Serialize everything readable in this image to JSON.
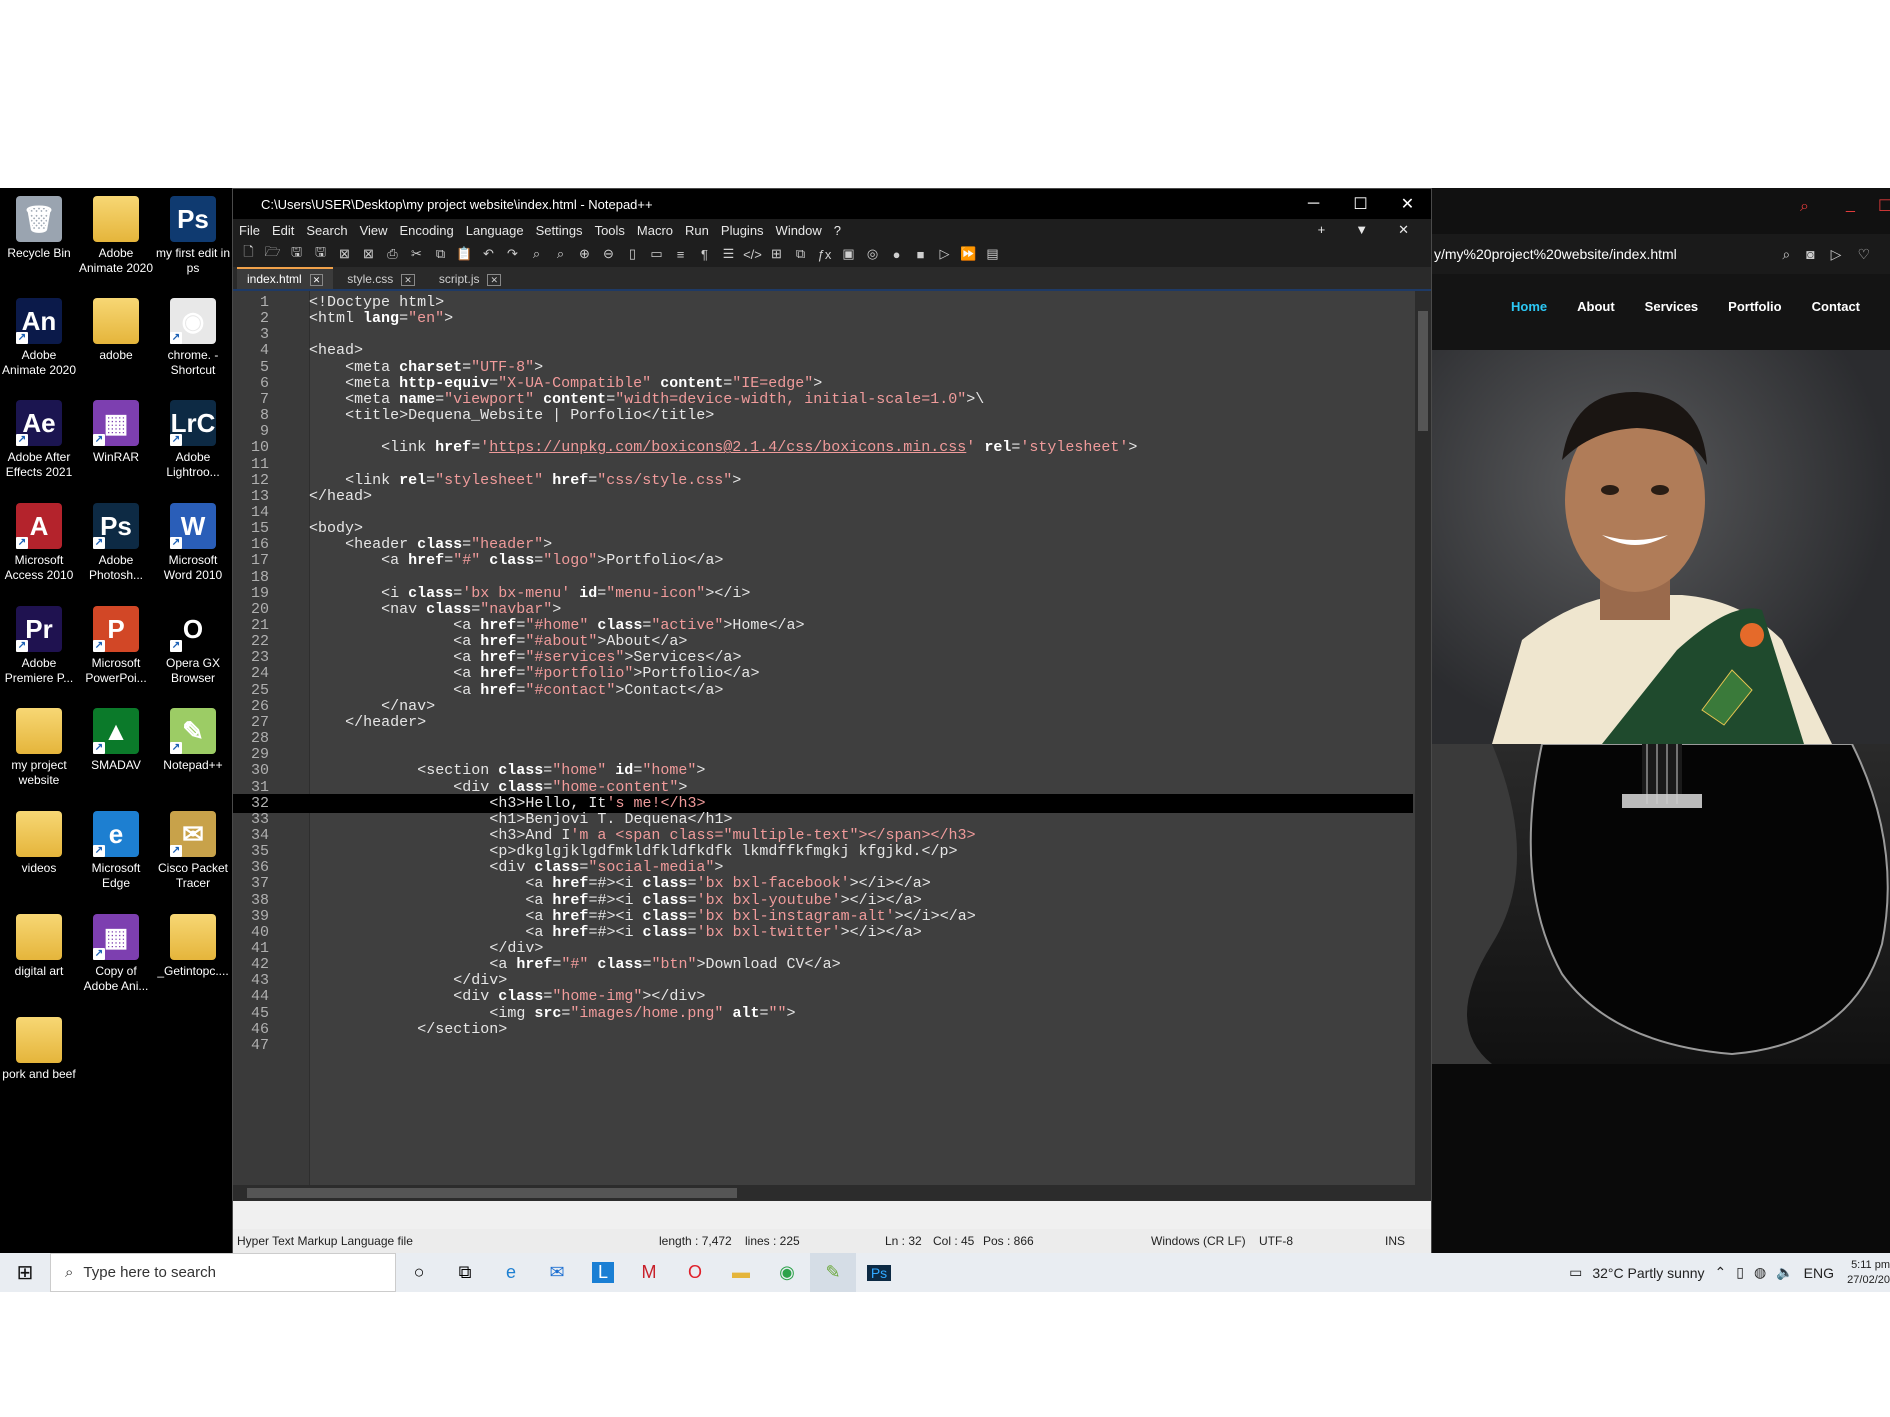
{
  "desktop": {
    "icons": [
      {
        "label": "Recycle Bin",
        "glyph": "🗑",
        "color": "#9aa4b0",
        "shortcut": false
      },
      {
        "label": "Adobe Animate 2020",
        "glyph": "",
        "color": "folder",
        "shortcut": false
      },
      {
        "label": "my first edit in ps",
        "glyph": "Ps",
        "color": "#0f3a70",
        "shortcut": false
      },
      {
        "label": "Adobe Animate 2020",
        "glyph": "An",
        "color": "#0b1a4a",
        "shortcut": true
      },
      {
        "label": "adobe",
        "glyph": "",
        "color": "folder",
        "shortcut": false
      },
      {
        "label": "chrome. - Shortcut",
        "glyph": "◉",
        "color": "#e8e8e8",
        "shortcut": true
      },
      {
        "label": "Adobe After Effects 2021",
        "glyph": "Ae",
        "color": "#1b1550",
        "shortcut": true
      },
      {
        "label": "WinRAR",
        "glyph": "▦",
        "color": "#7d3fb0",
        "shortcut": true
      },
      {
        "label": "Adobe Lightroo...",
        "glyph": "LrC",
        "color": "#0d2a44",
        "shortcut": true
      },
      {
        "label": "Microsoft Access 2010",
        "glyph": "A",
        "color": "#b4232c",
        "shortcut": true
      },
      {
        "label": "Adobe Photosh...",
        "glyph": "Ps",
        "color": "#0d2a44",
        "shortcut": true
      },
      {
        "label": "Microsoft Word 2010",
        "glyph": "W",
        "color": "#2a5eb8",
        "shortcut": true
      },
      {
        "label": "Adobe Premiere P...",
        "glyph": "Pr",
        "color": "#1f1250",
        "shortcut": true
      },
      {
        "label": "Microsoft PowerPoi...",
        "glyph": "P",
        "color": "#d24726",
        "shortcut": true
      },
      {
        "label": "Opera GX Browser",
        "glyph": "O",
        "color": "#000000",
        "shortcut": true
      },
      {
        "label": "my project website",
        "glyph": "",
        "color": "folder",
        "shortcut": false
      },
      {
        "label": "SMADAV",
        "glyph": "▲",
        "color": "#0b7a2a",
        "shortcut": true
      },
      {
        "label": "Notepad++",
        "glyph": "✎",
        "color": "#9ccc65",
        "shortcut": true
      },
      {
        "label": "videos",
        "glyph": "",
        "color": "folder",
        "shortcut": false
      },
      {
        "label": "Microsoft Edge",
        "glyph": "e",
        "color": "#1d7fd1",
        "shortcut": true
      },
      {
        "label": "Cisco Packet Tracer",
        "glyph": "✉",
        "color": "#c8a24a",
        "shortcut": true
      },
      {
        "label": "digital art",
        "glyph": "",
        "color": "folder",
        "shortcut": false
      },
      {
        "label": "Copy of Adobe Ani...",
        "glyph": "▦",
        "color": "#7d3fb0",
        "shortcut": true
      },
      {
        "label": "_Getintopc....",
        "glyph": "",
        "color": "folder",
        "shortcut": false
      },
      {
        "label": "pork and beef",
        "glyph": "",
        "color": "folder",
        "shortcut": false
      }
    ]
  },
  "notepad": {
    "title": "C:\\Users\\USER\\Desktop\\my project website\\index.html - Notepad++",
    "menu": [
      "File",
      "Edit",
      "Search",
      "View",
      "Encoding",
      "Language",
      "Settings",
      "Tools",
      "Macro",
      "Run",
      "Plugins",
      "Window",
      "?"
    ],
    "tabs": [
      {
        "label": "index.html",
        "active": true
      },
      {
        "label": "style.css",
        "active": false
      },
      {
        "label": "script.js",
        "active": false
      }
    ],
    "current_line": 32,
    "lines": [
      "<!Doctype html>",
      "<html lang=\"en\">",
      "",
      "<head>",
      "    <meta charset=\"UTF-8\">",
      "    <meta http-equiv=\"X-UA-Compatible\" content=\"IE=edge\">",
      "    <meta name=\"viewport\" content=\"width=device-width, initial-scale=1.0\">\\",
      "    <title>Dequena_Website | Porfolio</title>",
      "",
      "        <link href='https://unpkg.com/boxicons@2.1.4/css/boxicons.min.css' rel='stylesheet'>",
      "",
      "    <link rel=\"stylesheet\" href=\"css/style.css\">",
      "</head>",
      "",
      "<body>",
      "    <header class=\"header\">",
      "        <a href=\"#\" class=\"logo\">Portfolio</a>",
      "",
      "        <i class='bx bx-menu' id=\"menu-icon\"></i>",
      "        <nav class=\"navbar\">",
      "                <a href=\"#home\" class=\"active\">Home</a>",
      "                <a href=\"#about\">About</a>",
      "                <a href=\"#services\">Services</a>",
      "                <a href=\"#portfolio\">Portfolio</a>",
      "                <a href=\"#contact\">Contact</a>",
      "        </nav>",
      "    </header>",
      "",
      "",
      "            <section class=\"home\" id=\"home\">",
      "                <div class=\"home-content\">",
      "                    <h3>Hello, It's me!</h3>",
      "                    <h1>Benjovi T. Dequena</h1>",
      "                    <h3>And I'm a <span class=\"multiple-text\"></span></h3>",
      "                    <p>dkglgjklgdfmkldfkldfkdfk lkmdffkfmgkj kfgjkd.</p>",
      "                    <div class=\"social-media\">",
      "                        <a href=#><i class='bx bxl-facebook'></i></a>",
      "                        <a href=#><i class='bx bxl-youtube'></i></a>",
      "                        <a href=#><i class='bx bxl-instagram-alt'></i></a>",
      "                        <a href=#><i class='bx bxl-twitter'></i></a>",
      "                    </div>",
      "                    <a href=\"#\" class=\"btn\">Download CV</a>",
      "                </div>",
      "                <div class=\"home-img\"></div>",
      "                    <img src=\"images/home.png\" alt=\"\">",
      "            </section>",
      ""
    ],
    "status": {
      "filetype": "Hyper Text Markup Language file",
      "length": "length : 7,472",
      "lines": "lines : 225",
      "ln": "Ln : 32",
      "col": "Col : 45",
      "pos": "Pos : 866",
      "eol": "Windows (CR LF)",
      "encoding": "UTF-8",
      "mode": "INS"
    }
  },
  "browser": {
    "url": "y/my%20project%20website/index.html",
    "nav": [
      "Home",
      "About",
      "Services",
      "Portfolio",
      "Contact"
    ],
    "active_nav": "Home",
    "accent": "#2cc8f5"
  },
  "taskbar": {
    "search_placeholder": "Type here to search",
    "weather": "32°C  Partly sunny",
    "language": "ENG",
    "time": "5:11 pm",
    "date": "27/02/20"
  }
}
